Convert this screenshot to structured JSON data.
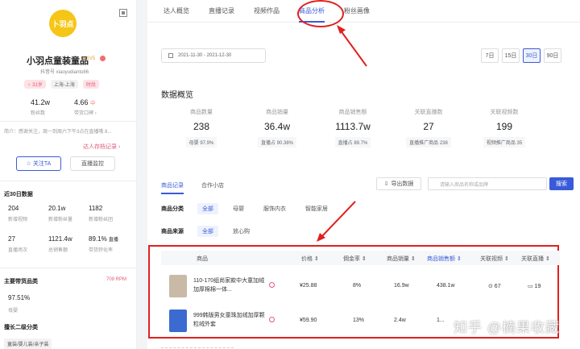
{
  "sidebar": {
    "logo_text": "卜羽点",
    "name": "小羽点童装童品",
    "badge": "♛1V5",
    "douyin_id": "抖音号 xiaoyudianto86",
    "tags": [
      "♀ 31岁",
      "上海-上海",
      "时尚"
    ],
    "stats": [
      {
        "value": "41.2w",
        "label": "粉丝数"
      },
      {
        "value": "4.66",
        "mini": "中",
        "label": "带货口碑 ›"
      }
    ],
    "intro": "简介：感谢关注，周一到周六下午3点在直播哦 8...",
    "archive_link": "达人存档记录 ›",
    "follow_btn": "☆ 关注TA",
    "live_btn": "直播监控",
    "recent_title": "近30日数据",
    "recent_row1": [
      {
        "value": "204",
        "label": "新增视频"
      },
      {
        "value": "20.1w",
        "label": "新增粉丝量"
      },
      {
        "value": "1182",
        "label": "新增粉丝团"
      }
    ],
    "recent_row2": [
      {
        "value": "27",
        "label": "直播场次"
      },
      {
        "value": "1121.4w",
        "label": "总销售额"
      },
      {
        "value": "89.1%",
        "mini": "直播",
        "label": "带货转化率"
      }
    ],
    "main_cat_title": "主要带货品类",
    "rpm": "709 RPM",
    "share_value": "97.51%",
    "share_label": "母婴",
    "sub_cat_title": "擅长二级分类",
    "sub_cat_tag": "童装/婴儿装/亲子装"
  },
  "tabs": [
    "达人概览",
    "直播记录",
    "视频作品",
    "商品分析",
    "粉丝画像"
  ],
  "active_tab": 3,
  "date_range": "2021-11-30  -  2021-12-30",
  "day_options": [
    "7日",
    "15日",
    "30日",
    "90日"
  ],
  "overview_title": "数据概览",
  "metrics": [
    {
      "label": "商品数量",
      "value": "238",
      "sub": "母婴 97.9%"
    },
    {
      "label": "商品销量",
      "value": "36.4w",
      "sub": "直播占 90.38%"
    },
    {
      "label": "商品销售额",
      "value": "1113.7w",
      "sub": "直播占 89.7%"
    },
    {
      "label": "关联直播数",
      "value": "27",
      "sub": "直播推广商品 238"
    },
    {
      "label": "关联视频数",
      "value": "199",
      "sub": "视频推广商品 35"
    }
  ],
  "subtabs": [
    "商品记录",
    "合作小店"
  ],
  "export_label": "导出数据",
  "search_placeholder": "请输入商品名称或品牌",
  "search_btn": "搜索",
  "filter_cat": {
    "key": "商品分类",
    "options": [
      "全部",
      "母婴",
      "服饰内衣",
      "智能家居"
    ]
  },
  "filter_src": {
    "key": "商品来源",
    "options": [
      "全部",
      "放心购"
    ]
  },
  "table": {
    "headers": [
      "商品",
      "价格 ⇕",
      "佣金率 ⇕",
      "商品销量 ⇕",
      "商品销售额 ⇕",
      "关联视频 ⇕",
      "关联直播 ⇕"
    ],
    "rows": [
      {
        "name": "110-170组尚家款中大童加绒加厚棉棉一体...",
        "price": "¥25.88",
        "commission": "8%",
        "sales": "16.9w",
        "revenue": "438.1w",
        "videos": "⊙ 67",
        "live": "▭ 19"
      },
      {
        "name": "999韩版男女童珠加绒加厚颗粒绒外套",
        "price": "¥59.90",
        "commission": "13%",
        "sales": "2.4w",
        "revenue": "1...",
        "videos": "",
        "live": ""
      }
    ]
  },
  "watermark": "知乎 @楠果收藏"
}
